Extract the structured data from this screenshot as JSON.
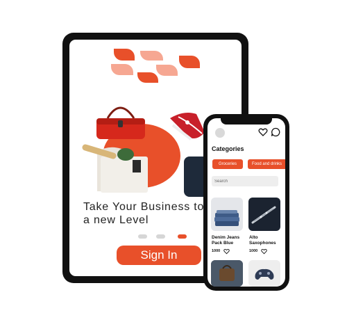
{
  "tablet": {
    "tagline": "Take Your Business to\na new Level",
    "signin_label": "Sign In",
    "pager": {
      "total": 3,
      "active": 3
    },
    "brand_colors": {
      "primary": "#e8502a",
      "light": "#f6a792"
    }
  },
  "phone": {
    "section_title": "Categories",
    "chips": [
      "Groceries",
      "Food and drinks"
    ],
    "search_placeholder": "Search",
    "products": [
      {
        "name": "Denim Jeans\nPack Blue",
        "price": "1000"
      },
      {
        "name": "Alto\nSaxophones",
        "price": "1000"
      },
      {
        "name": "",
        "price": ""
      },
      {
        "name": "",
        "price": ""
      }
    ]
  }
}
